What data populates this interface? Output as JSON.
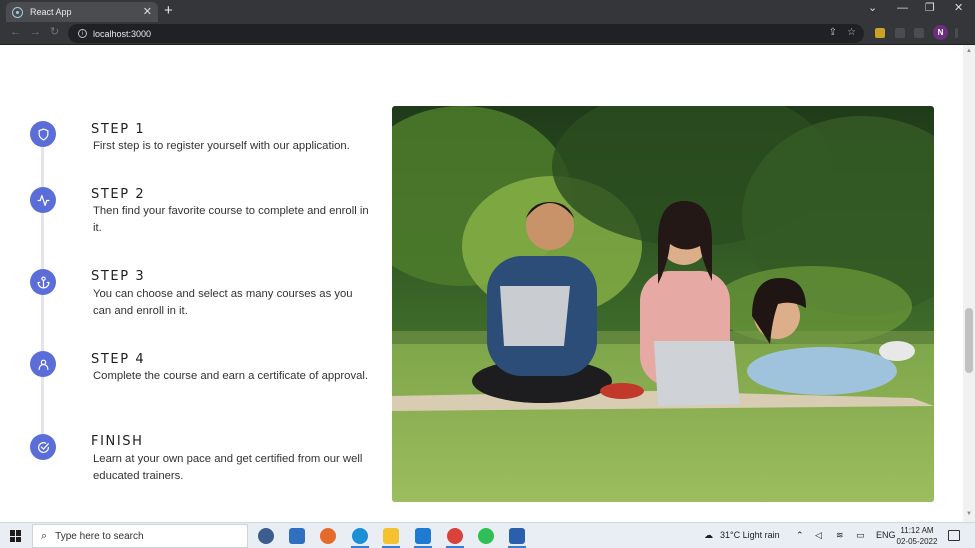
{
  "browser": {
    "tab_title": "React App",
    "tab_close": "✕",
    "new_tab": "+",
    "url": "localhost:3000",
    "profile_initial": "N",
    "window_controls": {
      "chevron": "⌄",
      "minimize": "—",
      "restore": "❐",
      "close": "✕"
    }
  },
  "steps": [
    {
      "title": "STEP 1",
      "text": "First step is to register yourself with our application.",
      "icon": "shield-icon"
    },
    {
      "title": "STEP 2",
      "text": "Then find your favorite course to complete and enroll in it.",
      "icon": "activity-icon"
    },
    {
      "title": "STEP 3",
      "text": "You can choose and select as many courses as you can and enroll in it.",
      "icon": "anchor-icon"
    },
    {
      "title": "STEP 4",
      "text": "Complete the course and earn a certificate of approval.",
      "icon": "user-icon"
    },
    {
      "title": "FINISH",
      "text": "Learn at your own pace and get certified from our well educated trainers.",
      "icon": "check-circle-icon"
    }
  ],
  "colors": {
    "accent": "#5b6ed8",
    "timeline": "#e3e4ee"
  },
  "taskbar": {
    "search_placeholder": "Type here to search",
    "weather": "31°C  Light rain",
    "language": "ENG",
    "time": "11:12 AM",
    "date": "02-05-2022",
    "apps": [
      "task-view-icon",
      "mail-icon",
      "firefox-icon",
      "edge-icon",
      "file-explorer-icon",
      "vscode-icon",
      "chrome-icon",
      "whatsapp-icon",
      "word-icon"
    ]
  }
}
